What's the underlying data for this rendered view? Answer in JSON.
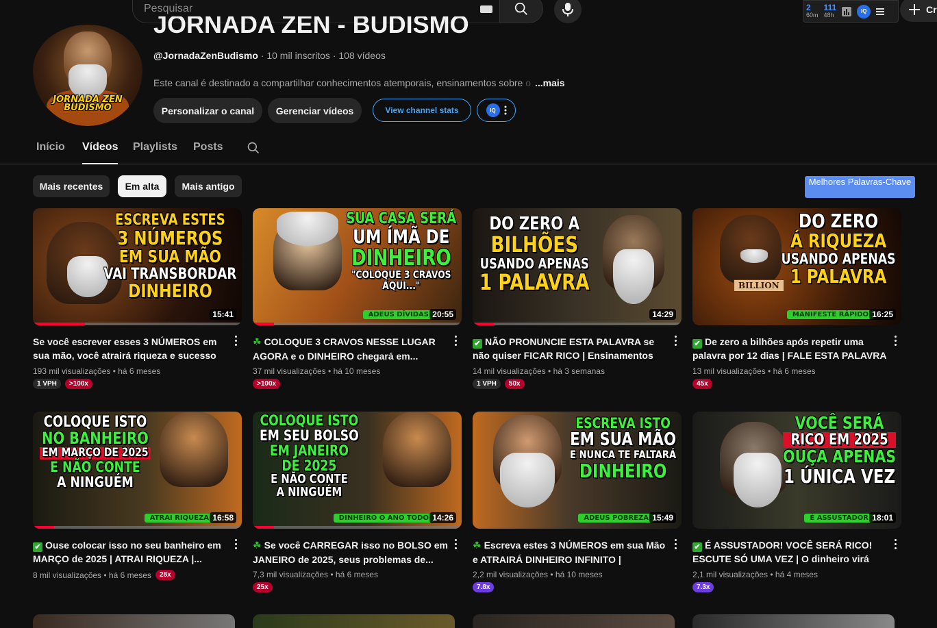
{
  "topbar": {
    "search_placeholder": "Pesquisar",
    "ext_stats": [
      {
        "n": "2",
        "u": "60m"
      },
      {
        "n": "111",
        "u": "48h"
      }
    ],
    "ext_iq": "IQ",
    "create_label": "Cri"
  },
  "channel": {
    "title": "JORNADA ZEN - BUDISMO",
    "handle": "@JornadaZenBudismo",
    "subscribers": " · 10 mil inscritos · 108 vídeos",
    "description": "Este canal é destinado a compartilhar conhecimentos atemporais, ensinamentos sobre ",
    "description_fade": "o",
    "more_label": "...mais",
    "avatar_logo_line1": "JORNADA ZEN",
    "avatar_logo_line2": "BUDISMO",
    "btn_customize": "Personalizar o canal",
    "btn_manage": "Gerenciar vídeos",
    "btn_stats": "View channel stats",
    "btn_iq": "IQ"
  },
  "tabs": [
    "Início",
    "Vídeos",
    "Playlists",
    "Posts"
  ],
  "filters": [
    "Mais recentes",
    "Em alta",
    "Mais antigo"
  ],
  "keywords_button": "Melhores Palavras-Chave",
  "videos": [
    {
      "title": "Se você escrever esses 3 NÚMEROS em sua mão, você atrairá riqueza e sucesso |...",
      "views": "193 mil visualizações",
      "age": "há 6 meses",
      "duration": "15:41",
      "progress": 0.25,
      "badges": [
        "1 VPH",
        ">100x"
      ],
      "thumb_lines": [
        "ESCREVA ESTES",
        "3 NÚMEROS",
        "EM SUA MÃO",
        "VAI TRANSBORDAR",
        "DINHEIRO"
      ]
    },
    {
      "title": "COLOQUE 3 CRAVOS NESSE LUGAR AGORA e o DINHEIRO chegará em...",
      "views": "37 mil visualizações",
      "age": "há 10 meses",
      "duration": "20:55",
      "progress": 0.1,
      "badges": [
        ">100x"
      ],
      "emoji": "☘",
      "thumb_lines": [
        "SUA CASA SERÁ",
        "UM ÍMÃ DE",
        "DINHEIRO",
        "\"COLOQUE 3 CRAVOS",
        "AQUI...\""
      ],
      "tag": "ADEUS DÍVIDAS"
    },
    {
      "title": "NÃO PRONUNCIE ESTA PALAVRA se não quiser FICAR RICO | Ensinamentos Budistas",
      "views": "14 mil visualizações",
      "age": "há 3 semanas",
      "duration": "14:29",
      "progress": 0.1,
      "badges": [
        "1 VPH",
        "50x"
      ],
      "emoji": "✔",
      "thumb_lines": [
        "DO ZERO A",
        "BILHÕES",
        "USANDO APENAS",
        "1 PALAVRA"
      ]
    },
    {
      "title": "De zero a bilhões após repetir uma palavra por 12 dias | FALE ESTA PALAVRA ...",
      "views": "13 mil visualizações",
      "age": "há 6 meses",
      "duration": "16:25",
      "progress": 0.0,
      "badges": [
        "45x"
      ],
      "emoji": "✔",
      "thumb_lines": [
        "DO ZERO",
        "Á RIQUEZA",
        "USANDO APENAS",
        "1 PALAVRA"
      ],
      "tag": "MANIFESTE RÁPIDO",
      "billion": "BILLION"
    },
    {
      "title": "Ouse colocar isso no seu banheiro em MARÇO de 2025 | ATRAI RIQUEZA |...",
      "views": "8 mil visualizações",
      "age": "há 6 meses",
      "duration": "16:58",
      "progress": 0.1,
      "badges": [
        "28x"
      ],
      "emoji": "✔",
      "thumb_lines": [
        "COLOQUE ISTO",
        "NO BANHEIRO",
        "EM MARÇO DE 2025",
        "E NÃO CONTE",
        "A NINGUÉM"
      ],
      "tag": "ATRAI RIQUEZA"
    },
    {
      "title": "Se você CARREGAR isso no BOLSO em JANEIRO de 2025, seus problemas de...",
      "views": "7,3 mil visualizações",
      "age": "há 6 meses",
      "duration": "14:26",
      "progress": 0.1,
      "badges": [
        "25x"
      ],
      "emoji": "☘",
      "thumb_lines": [
        "COLOQUE ISTO",
        "EM SEU BOLSO",
        "EM JANEIRO",
        "DE 2025",
        "E NÃO CONTE",
        "A NINGUÉM"
      ],
      "tag": "DINHEIRO O ANO TODO"
    },
    {
      "title": "Escreva estes 3 NÚMEROS em sua Mão e ATRAIRÁ DINHEIRO INFINITO | Sabedoria...",
      "views": "2,2 mil visualizações",
      "age": "há 10 meses",
      "duration": "15:49",
      "progress": 0.0,
      "badges": [
        "7.8x"
      ],
      "emoji": "☘",
      "thumb_lines": [
        "ESCREVA ISTO",
        "EM SUA MÃO",
        "E NUNCA TE FALTARÁ",
        "DINHEIRO"
      ],
      "tag": "ADEUS POBREZA"
    },
    {
      "title": "É ASSUSTADOR! VOCÊ SERÁ RICO! ESCUTE SÓ UMA VEZ | O dinheiro virá até...",
      "views": "2,1 mil visualizações",
      "age": "há 4 meses",
      "duration": "18:01",
      "progress": 0.0,
      "badges": [
        "7.3x"
      ],
      "emoji": "✔",
      "thumb_lines": [
        "VOCÊ SERÁ",
        "RICO EM 2025",
        "OUÇA APENAS",
        "1 ÚNICA VEZ"
      ],
      "tag": "É ASSUSTADOR"
    }
  ],
  "colors": {
    "bg": "#0f0f0f",
    "accent_blue": "#3ea6ff",
    "progress_red": "#ff0033",
    "badge_red": "#b4002a",
    "badge_purple": "#6e3de0",
    "thumb_yellow": "#ffd21a",
    "thumb_green": "#3df03d"
  }
}
